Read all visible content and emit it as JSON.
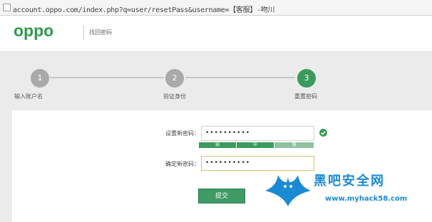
{
  "browser": {
    "url": "account.oppo.com/index.php?q=user/resetPass&username=【客服】-吻川"
  },
  "header": {
    "logo": "oppo",
    "subtitle": "找回密码"
  },
  "steps": [
    {
      "number": "1",
      "label": "输入账户名",
      "active": false
    },
    {
      "number": "2",
      "label": "验证身份",
      "active": false
    },
    {
      "number": "3",
      "label": "重置密码",
      "active": true
    }
  ],
  "form": {
    "new_password_label": "设置新密码：",
    "new_password_value": "••••••••••",
    "strength": [
      {
        "label": "弱",
        "color": "#3a9b5c"
      },
      {
        "label": "中",
        "color": "#3a9b5c"
      },
      {
        "label": "强",
        "color": "#8fc2a0"
      }
    ],
    "confirm_password_label": "确定新密码：",
    "confirm_password_value": "••••••••••",
    "submit_label": "提交"
  },
  "watermark": {
    "title": "黑吧安全网",
    "url": "www.myhack58.com"
  },
  "colors": {
    "brand_green": "#2f9a4f",
    "watermark_blue": "#1a8ad4"
  }
}
